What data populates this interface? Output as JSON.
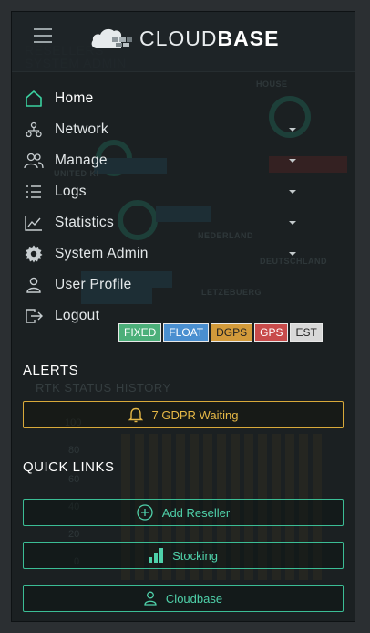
{
  "header": {
    "menu_toggle": "hamburger-icon",
    "brand_light": "CLOUD",
    "brand_bold": "BASE"
  },
  "menu": {
    "items": [
      {
        "label": "Home",
        "icon": "home-icon",
        "active": true,
        "has_submenu": false
      },
      {
        "label": "Network",
        "icon": "network-icon",
        "active": false,
        "has_submenu": true
      },
      {
        "label": "Manage",
        "icon": "users-icon",
        "active": false,
        "has_submenu": true
      },
      {
        "label": "Logs",
        "icon": "list-icon",
        "active": false,
        "has_submenu": true
      },
      {
        "label": "Statistics",
        "icon": "chart-icon",
        "active": false,
        "has_submenu": true
      },
      {
        "label": "System Admin",
        "icon": "gear-icon",
        "active": false,
        "has_submenu": true
      },
      {
        "label": "User Profile",
        "icon": "user-icon",
        "active": false,
        "has_submenu": false
      },
      {
        "label": "Logout",
        "icon": "logout-icon",
        "active": false,
        "has_submenu": false
      }
    ]
  },
  "status_chips": [
    {
      "label": "FIXED",
      "color": "#4caf7a"
    },
    {
      "label": "FLOAT",
      "color": "#4a8fd0"
    },
    {
      "label": "DGPS",
      "color": "#d29a3a"
    },
    {
      "label": "GPS",
      "color": "#c84b4b"
    },
    {
      "label": "EST",
      "color": "#d8d8d8"
    }
  ],
  "alerts": {
    "title": "ALERTS",
    "gdpr_button": "7 GDPR Waiting",
    "gdpr_icon": "bell-icon"
  },
  "quick_links": {
    "title": "QUICK LINKS",
    "items": [
      {
        "label": "Add Reseller",
        "icon": "plus-circle-icon"
      },
      {
        "label": "Stocking",
        "icon": "signal-bars-icon"
      },
      {
        "label": "Cloudbase",
        "icon": "user-icon"
      }
    ]
  },
  "colors": {
    "accent_green": "#3bbd95",
    "alert_amber": "#d8a93a",
    "background": "#1b2022"
  }
}
